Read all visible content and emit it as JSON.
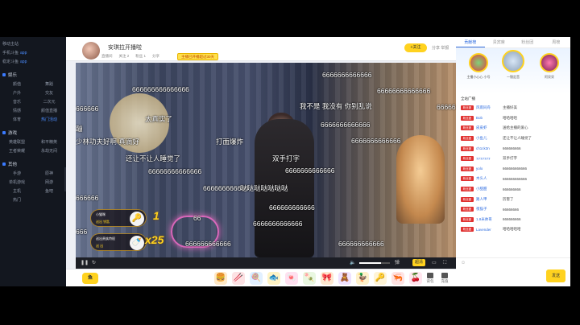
{
  "sidebar": {
    "top": [
      {
        "label": "移动主站"
      },
      {
        "label": "手机斗鱼",
        "tag": "app"
      },
      {
        "label": "稳定斗鱼",
        "tag": "app"
      }
    ],
    "sections": [
      {
        "title": "娱乐",
        "items": [
          "颜值",
          "舞蹈",
          "户外",
          "交友",
          "音乐",
          "二次元",
          "情感",
          "颜值直播",
          "体育",
          "热门活动"
        ],
        "highlight": [
          9
        ]
      },
      {
        "title": "游戏",
        "items": [
          "英雄联盟",
          "和平精英",
          "王者荣耀",
          "永劫无间"
        ],
        "highlight": []
      },
      {
        "title": "其他",
        "items": [
          "手游",
          "原神",
          "单机游戏",
          "网游",
          "主机",
          "鱼吧",
          "热门"
        ],
        "highlight": []
      }
    ]
  },
  "anchor": {
    "name": "安琪拉开播啦",
    "sub": [
      "直播间",
      "关注 2",
      "粉丝 1",
      "分享"
    ],
    "badge": "主播已开播超过30天",
    "follow": "+关注",
    "share": "分享 举报"
  },
  "danmu": [
    "6666666666666",
    "666666666666666",
    "66666666666666",
    "666666",
    "我不是 我没有 你别乱说",
    "66666",
    "太真实了",
    "6666666666666",
    "蹦",
    "少林功夫好啊 真滴好",
    "打面爆炸",
    "6666666666666",
    "还让不让人睡觉了",
    "双手打字",
    "6666666666666",
    "66666666666666",
    "666666666666",
    "哒哒哒哒哒哒哒",
    "666666",
    "666666666666",
    "6666666666666",
    "666",
    "666666666666",
    "666666666666",
    "66"
  ],
  "gifts_overlay": [
    {
      "name": "小猫咪",
      "text": "送出 钥匙",
      "icon": "🔑",
      "combo": "1"
    },
    {
      "name": "送出贵族特权",
      "text": "送 出",
      "icon": "🍼",
      "combo": "x25"
    }
  ],
  "controls": {
    "play": "❚❚",
    "refresh": "↻",
    "volume_icon": "🔈",
    "quality": "超清",
    "danmu_toggle": "弹",
    "fullscreen": "⛶",
    "wide": "▭",
    "volume_level": 0.7
  },
  "giftbar": {
    "logo": "鱼",
    "gift_icons": [
      "🍔",
      "🥢",
      "🍭",
      "🐟",
      "🍬",
      "🍡",
      "🎀",
      "🧸",
      "🦆",
      "🔑",
      "🦐",
      "🍒"
    ],
    "ext": [
      "背包",
      "充值"
    ]
  },
  "right": {
    "tabs": [
      "贡献榜",
      "贵宾席",
      "粉丝团",
      "周榜"
    ],
    "ranks": [
      {
        "name": "主播小心心 小号"
      },
      {
        "name": "一锤定音"
      },
      {
        "name": "阿呆呆"
      }
    ],
    "chat_head": "全站广播",
    "messages": [
      {
        "lv": "粉丝团",
        "name": "风雨同舟",
        "text": "主播好美"
      },
      {
        "lv": "粉丝团",
        "name": "Bob",
        "text": "哈哈哈哈"
      },
      {
        "lv": "粉丝团",
        "name": "皮皮虾",
        "text": "送给主播的爱心"
      },
      {
        "lv": "粉丝团",
        "name": "小鱼儿",
        "text": "还让不让人睡觉了"
      },
      {
        "lv": "粉丝团",
        "name": "ch1ck3n",
        "text": "666666666"
      },
      {
        "lv": "粉丝团",
        "name": "7777777",
        "text": "双手打字"
      },
      {
        "lv": "粉丝团",
        "name": "yolo",
        "text": "666666666666"
      },
      {
        "lv": "粉丝团",
        "name": "木头人",
        "text": "666666666666"
      },
      {
        "lv": "粉丝团",
        "name": "小甜甜",
        "text": "666666666"
      },
      {
        "lv": "粉丝团",
        "name": "路人甲",
        "text": "厉害了"
      },
      {
        "lv": "粉丝团",
        "name": "夜猫子",
        "text": "66666666"
      },
      {
        "lv": "粉丝团",
        "name": "1.8米帅哥",
        "text": "666666666"
      },
      {
        "lv": "粉丝团",
        "name": "Lavender",
        "text": "哈哈哈哈哈"
      }
    ],
    "send": "发送",
    "tools": "☺"
  }
}
